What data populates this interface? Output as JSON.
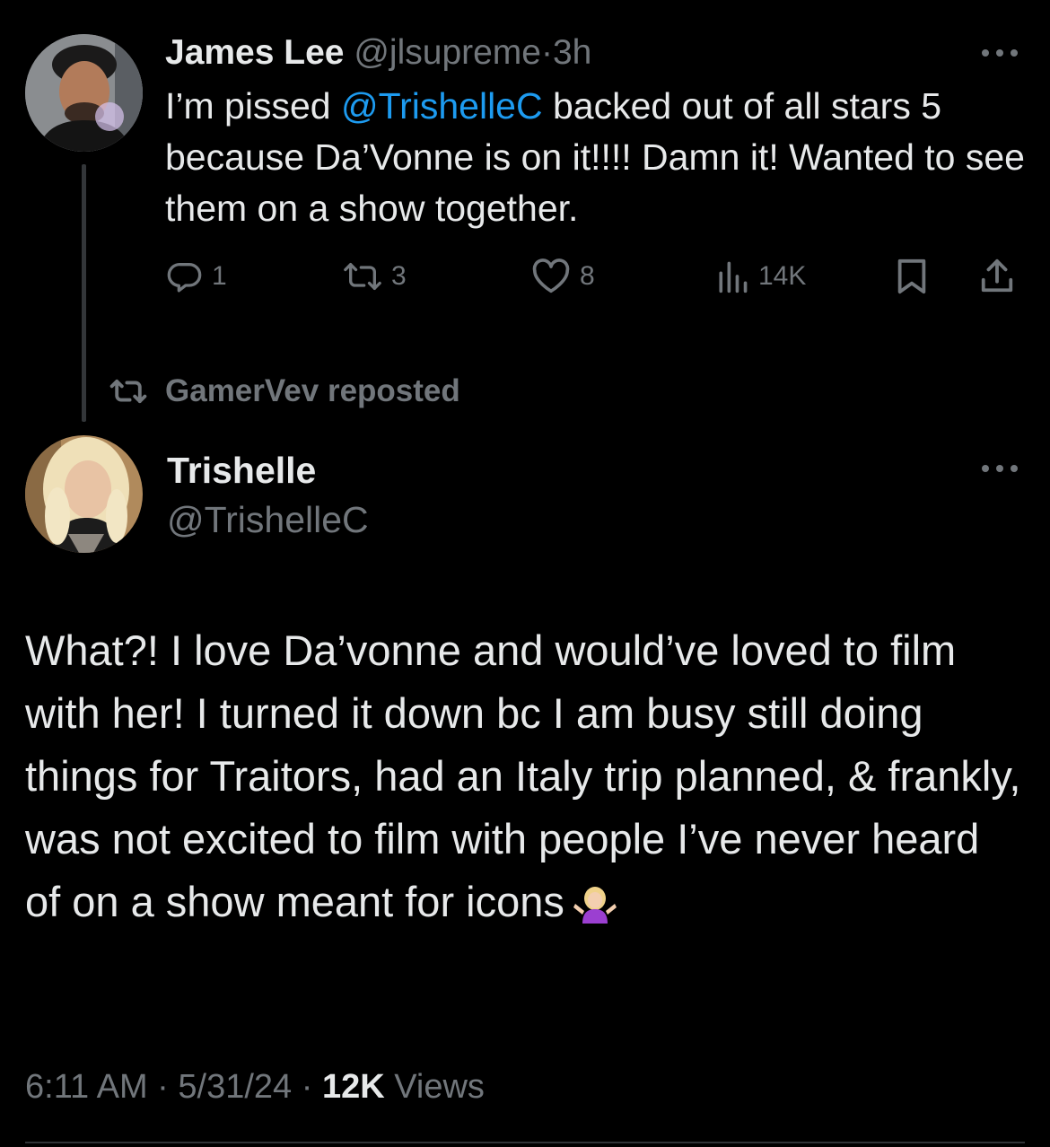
{
  "colors": {
    "background": "#000000",
    "text": "#e7e9ea",
    "muted": "#71767b",
    "link": "#1d9bf0",
    "divider": "#2f3336"
  },
  "tweet1": {
    "display_name": "James Lee",
    "handle": "@jlsupreme",
    "separator": "·",
    "time": "3h",
    "text_before_mention": "I’m pissed ",
    "mention": "@TrishelleC",
    "text_after_mention": " backed out of all stars 5 because Da’Vonne is on it!!!! Damn it! Wanted to see them on a show together.",
    "more_icon": "ellipsis-icon",
    "actions": {
      "replies": "1",
      "reposts": "3",
      "likes": "8",
      "views": "14K",
      "bookmark_icon": "bookmark-icon",
      "share_icon": "share-icon"
    }
  },
  "repost_banner": {
    "icon": "repost-icon",
    "text": "GamerVev reposted"
  },
  "tweet2": {
    "display_name": "Trishelle",
    "handle": "@TrishelleC",
    "more_icon": "ellipsis-icon",
    "text": "What?! I love Da’vonne and would’ve loved to film with her! I turned it down bc I am busy still doing things for Traitors, had an Italy trip planned, & frankly, was not excited to film with people I’ve never heard of on a show meant for icons",
    "emoji": "person-shrugging-emoji",
    "meta": {
      "time": "6:11 AM",
      "separator": " · ",
      "date": "5/31/24",
      "views_count": "12K",
      "views_label": " Views"
    }
  }
}
